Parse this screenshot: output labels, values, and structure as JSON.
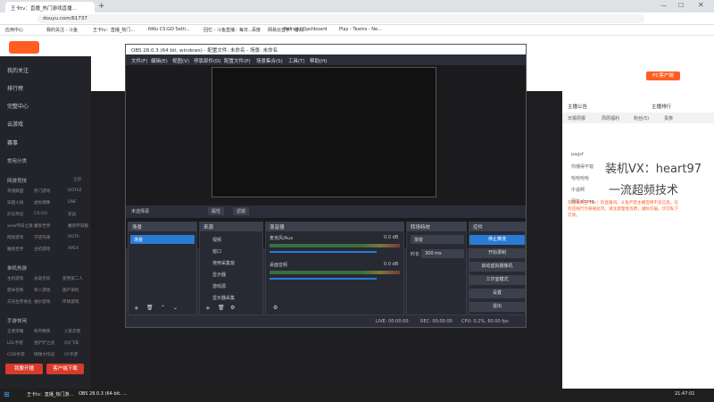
{
  "browser": {
    "tab_title": "王卡tv：直播_热门游戏直播...",
    "url": "douyu.com/61737",
    "bookmarks": [
      "应用中心",
      "我的关注 - 斗鱼",
      "王卡tv：直播_热门...",
      "NiKo CS:GO Setti...",
      "回忆 - 斗鱼直播：每日...",
      "百度",
      "网易云音乐：游戏...",
      "Refrag | Dashboard",
      "Play - Teams - Ne..."
    ]
  },
  "douyu": {
    "sidebar": {
      "items": [
        "我的关注",
        "排行榜",
        "完整中心",
        "云游戏",
        "赛事"
      ],
      "section_common": "常用分类",
      "section_online": "网游竞技",
      "online_games": [
        [
          "英雄联盟",
          "热门游戏",
          "DOTA2"
        ],
        [
          "穿越火线",
          "虚拟偶像",
          "DNF"
        ],
        [
          "炉石传说",
          "CS:GO",
          "逆战"
        ],
        [
          "wow怀旧之歌",
          "魔兽世界",
          "魔兽怀旧服"
        ],
        [
          "网易游戏",
          "守望先锋",
          "DOTA"
        ],
        [
          "魔兽世界",
          "主机游戏",
          "APEX"
        ]
      ],
      "section_single": "单机热游",
      "single_games": [
        [
          "主机游戏",
          "永劫无间",
          "使用第二人"
        ],
        [
          "使命召唤",
          "单人游戏",
          "国产单机"
        ],
        [
          "方舟生存进化",
          "维尔游戏",
          "环球游戏"
        ]
      ],
      "section_mobile": "手游休闲",
      "mobile_games": [
        [
          "王者荣耀",
          "和平精英",
          "火影忍者"
        ],
        [
          "LOL手游",
          "金铲铲之战",
          "QQ飞车"
        ],
        [
          "COD手游",
          "球球大作战",
          "CF手游"
        ]
      ],
      "more": "全部",
      "start_live": "我要开播",
      "download": "客户端下载"
    },
    "right_panel": {
      "pc_client": "PC客户端",
      "tabs": [
        "日报周报",
        "周周福利",
        "粉丝(5)",
        "贵族"
      ],
      "streamer_notice": "主播公告",
      "gift_rank": "主播排行",
      "chat_lines": [
        "pagsf",
        "你播得不错",
        "哈哈哈哈",
        "牛逼啊",
        "网友abong"
      ],
      "watermark_line1": "装机VX：heart97",
      "watermark_line2": "一流超频技术",
      "welcome_text": "欢迎来到王卡tv！的直播间。斗鱼严禁主播宣扬不良信息，任何违规行为将被处罚。请注意理性消费，谨防诈骗，切勿私下交易。"
    }
  },
  "obs": {
    "title": "OBS 28.0.3 (64 bit, windows) - 配置文件: 未命名 - 场景: 未命名",
    "menu": [
      "文件(F)",
      "编辑(E)",
      "视图(V)",
      "停靠部件(D)",
      "配置文件(P)",
      "场景集合(S)",
      "工具(T)",
      "帮助(H)"
    ],
    "no_source": "未选择源",
    "properties_label": "属性",
    "filters_label": "滤镜",
    "docks": {
      "scenes": {
        "title": "场景",
        "items": [
          "场景"
        ]
      },
      "sources": {
        "title": "来源",
        "items": [
          "视频",
          "窗口",
          "使用采集窗",
          "显示器",
          "游戏源",
          "显示器采集"
        ]
      },
      "mixer": {
        "title": "混音器",
        "channels": [
          {
            "name": "麦克风/Aux",
            "db": "0.0 dB"
          },
          {
            "name": "桌面音频",
            "db": "0.0 dB"
          }
        ]
      },
      "transitions": {
        "title": "转场特效",
        "type": "渐变",
        "duration_label": "时长",
        "duration_value": "300 ms"
      },
      "controls": {
        "title": "控件",
        "buttons": [
          "停止推流",
          "开始录制",
          "启动虚拟摄像机",
          "工作室模式",
          "设置",
          "退出"
        ]
      }
    },
    "status": {
      "live": "LIVE: 00:00:00",
      "rec": "REC: 00:00:00",
      "cpu": "CPU: 0.2%, 60.00 fps"
    }
  },
  "taskbar": {
    "items": [
      "王卡tv：直播_热门游...",
      "OBS 28.0.3 (64-bit, ..."
    ],
    "time": "21:47:01"
  },
  "colors": {
    "accent": "#2a7bd6",
    "douyu_orange": "#ff5d23",
    "live_red": "#d83b2b"
  }
}
